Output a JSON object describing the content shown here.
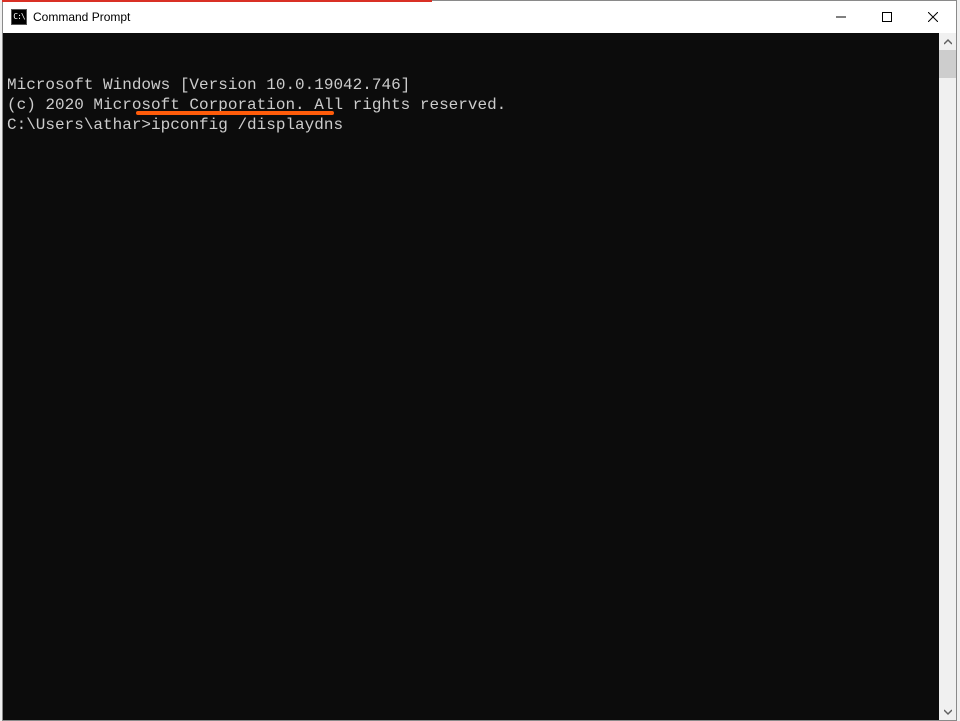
{
  "window": {
    "title": "Command Prompt"
  },
  "terminal": {
    "line1": "Microsoft Windows [Version 10.0.19042.746]",
    "line2": "(c) 2020 Microsoft Corporation. All rights reserved.",
    "blank": "",
    "prompt": "C:\\Users\\athar>",
    "command": "ipconfig /displaydns"
  }
}
